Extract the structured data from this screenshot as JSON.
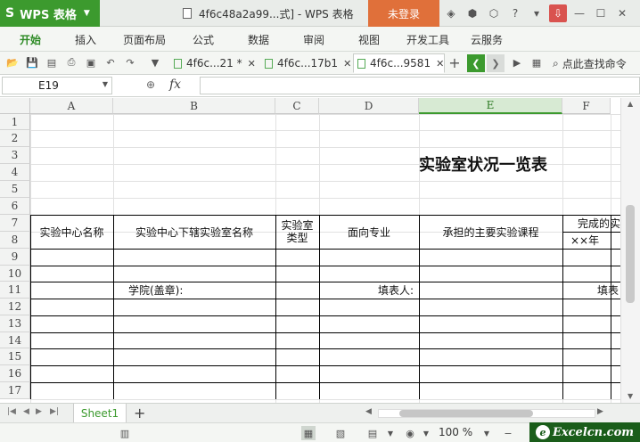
{
  "app": {
    "name": "WPS 表格",
    "logo": "S",
    "doc_title": "4f6c48a2a99...式] - WPS 表格",
    "login": "未登录"
  },
  "ribbon_tabs": [
    "开始",
    "插入",
    "页面布局",
    "公式",
    "数据",
    "审阅",
    "视图",
    "开发工具",
    "云服务"
  ],
  "doc_tabs": [
    {
      "label": "4f6c...21 *",
      "active": false
    },
    {
      "label": "4f6c...17b1",
      "active": false
    },
    {
      "label": "4f6c...9581",
      "active": true
    }
  ],
  "search_cmd": "点此查找命令",
  "formula_bar": {
    "name_box": "E19",
    "fx": "fx",
    "value": ""
  },
  "columns": [
    "A",
    "B",
    "C",
    "D",
    "E",
    "F"
  ],
  "selected_column": "E",
  "rows": [
    "1",
    "2",
    "3",
    "4",
    "5",
    "6",
    "7",
    "8",
    "9",
    "10",
    "11",
    "12",
    "13",
    "14",
    "15",
    "16",
    "17"
  ],
  "cells": {
    "title": "实验室状况一览表",
    "college_label": "学院(盖章):",
    "filler_label": "填表人:",
    "fill_date_label": "填表",
    "hdr_center_name": "实验中心名称",
    "hdr_lab_name": "实验中心下辖实验室名称",
    "hdr_lab_type": "实验室类型",
    "hdr_major": "面向专业",
    "hdr_courses": "承担的主要实验课程",
    "hdr_completed": "完成的实",
    "hdr_year": "××年"
  },
  "sheet": {
    "name": "Sheet1"
  },
  "status": {
    "zoom": "100 %"
  },
  "watermark": {
    "text": "Excelcn.com"
  }
}
